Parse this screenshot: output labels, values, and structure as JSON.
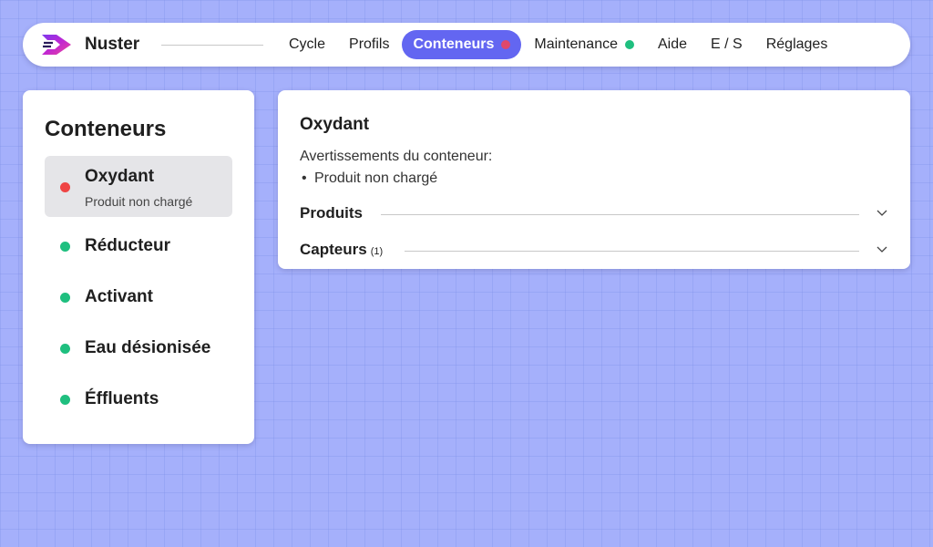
{
  "app": {
    "name": "Nuster"
  },
  "nav": {
    "items": [
      {
        "label": "Cycle"
      },
      {
        "label": "Profils"
      },
      {
        "label": "Conteneurs",
        "active": true,
        "status_color": "#e0486a"
      },
      {
        "label": "Maintenance",
        "status_color": "#1fbf7f"
      },
      {
        "label": "Aide"
      },
      {
        "label": "E / S"
      },
      {
        "label": "Réglages"
      }
    ]
  },
  "colors": {
    "accent": "#6366f1",
    "ok": "#1fbf7f",
    "error": "#ef4444",
    "background": "#a5b0fb"
  },
  "sidebar": {
    "title": "Conteneurs",
    "items": [
      {
        "label": "Oxydant",
        "sublabel": "Produit non chargé",
        "status": "error",
        "selected": true
      },
      {
        "label": "Réducteur",
        "status": "ok"
      },
      {
        "label": "Activant",
        "status": "ok"
      },
      {
        "label": "Eau désionisée",
        "status": "ok"
      },
      {
        "label": "Éffluents",
        "status": "ok"
      }
    ]
  },
  "detail": {
    "title": "Oxydant",
    "warnings_heading": "Avertissements du conteneur:",
    "warnings": [
      "Produit non chargé"
    ],
    "sections": [
      {
        "label": "Produits",
        "icon": "chevron-down-icon"
      },
      {
        "label": "Capteurs",
        "count": "(1)",
        "icon": "chevron-down-icon"
      }
    ]
  }
}
